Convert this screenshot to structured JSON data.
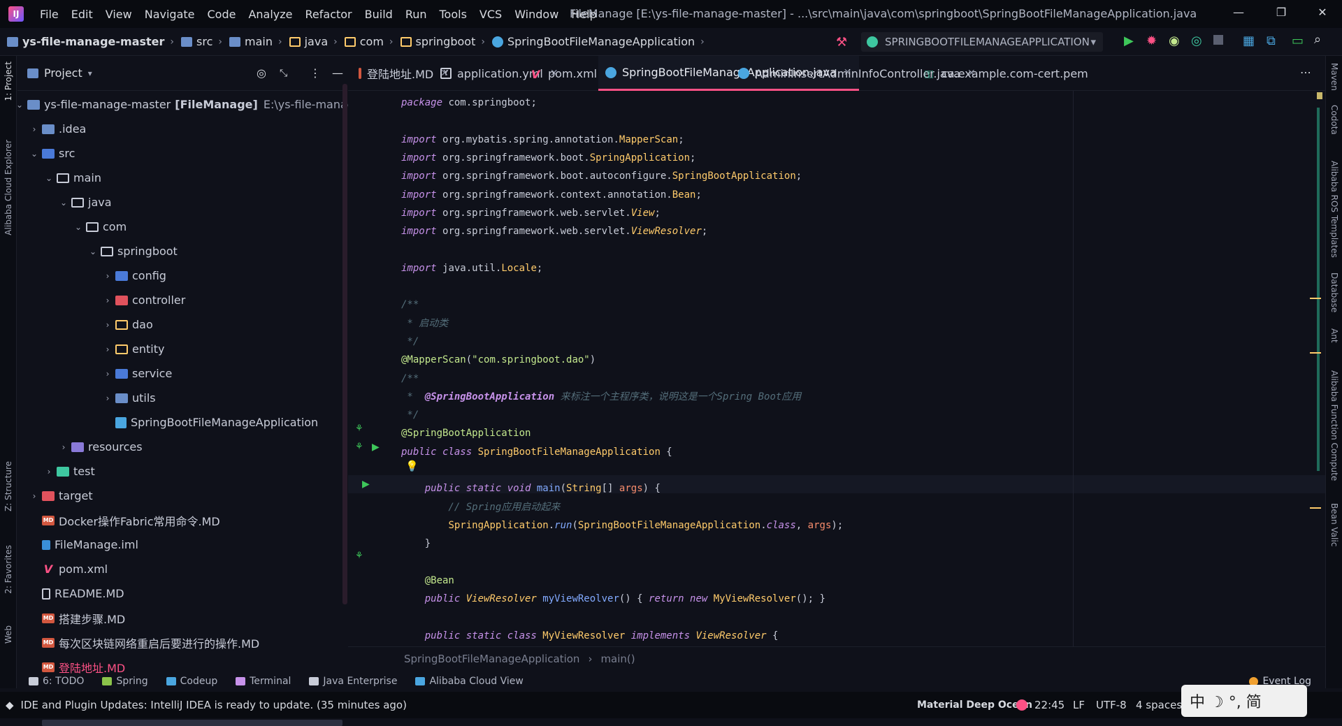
{
  "menu": [
    "File",
    "Edit",
    "View",
    "Navigate",
    "Code",
    "Analyze",
    "Refactor",
    "Build",
    "Run",
    "Tools",
    "VCS",
    "Window",
    "Help"
  ],
  "window_title": "FileManage [E:\\ys-file-manage-master] - ...\\src\\main\\java\\com\\springboot\\SpringBootFileManageApplication.java",
  "window_controls": {
    "minimize": "—",
    "restore": "❐",
    "close": "✕"
  },
  "breadcrumb": [
    "ys-file-manage-master",
    "src",
    "main",
    "java",
    "com",
    "springboot",
    "SpringBootFileManageApplication"
  ],
  "run_config": "SPRINGBOOTFILEMANAGEAPPLICATION",
  "left_strip": {
    "project": "1: Project",
    "cloud": "Alibaba Cloud Explorer",
    "structure": "Z: Structure",
    "favorites": "2: Favorites",
    "web": "Web"
  },
  "right_strip": [
    "Maven",
    "Codota",
    "Alibaba ROS Templates",
    "Database",
    "Ant",
    "Alibaba Function Compute",
    "Bean Valic"
  ],
  "project_panel": {
    "title": "Project",
    "tree": [
      {
        "label": "ys-file-manage-master",
        "bold": "[FileManage]",
        "path": "E:\\ys-file-manage-master",
        "depth": 0,
        "arrow": "⌄",
        "icon": "folder"
      },
      {
        "label": ".idea",
        "depth": 1,
        "arrow": "›",
        "icon": "folder"
      },
      {
        "label": "src",
        "depth": 1,
        "arrow": "⌄",
        "icon": "src"
      },
      {
        "label": "main",
        "depth": 2,
        "arrow": "⌄",
        "icon": "folder-o"
      },
      {
        "label": "java",
        "depth": 3,
        "arrow": "⌄",
        "icon": "folder-o"
      },
      {
        "label": "com",
        "depth": 4,
        "arrow": "⌄",
        "icon": "folder-o"
      },
      {
        "label": "springboot",
        "depth": 5,
        "arrow": "⌄",
        "icon": "folder-o"
      },
      {
        "label": "config",
        "depth": 6,
        "arrow": "›",
        "icon": "src"
      },
      {
        "label": "controller",
        "depth": 6,
        "arrow": "›",
        "icon": "target"
      },
      {
        "label": "dao",
        "depth": 6,
        "arrow": "›",
        "icon": "folder-y"
      },
      {
        "label": "entity",
        "depth": 6,
        "arrow": "›",
        "icon": "folder-y"
      },
      {
        "label": "service",
        "depth": 6,
        "arrow": "›",
        "icon": "src"
      },
      {
        "label": "utils",
        "depth": 6,
        "arrow": "›",
        "icon": "folder"
      },
      {
        "label": "SpringBootFileManageApplication",
        "depth": 6,
        "arrow": "",
        "icon": "java"
      },
      {
        "label": "resources",
        "depth": 3,
        "arrow": "›",
        "icon": "res"
      },
      {
        "label": "test",
        "depth": 2,
        "arrow": "›",
        "icon": "test"
      },
      {
        "label": "target",
        "depth": 1,
        "arrow": "›",
        "icon": "target"
      },
      {
        "label": "Docker操作Fabric常用命令.MD",
        "depth": 1,
        "arrow": "",
        "icon": "md"
      },
      {
        "label": "FileManage.iml",
        "depth": 1,
        "arrow": "",
        "icon": "iml"
      },
      {
        "label": "pom.xml",
        "depth": 1,
        "arrow": "",
        "icon": "pom"
      },
      {
        "label": "README.MD",
        "depth": 1,
        "arrow": "",
        "icon": "readme"
      },
      {
        "label": "搭建步骤.MD",
        "depth": 1,
        "arrow": "",
        "icon": "md"
      },
      {
        "label": "每次区块链网络重启后要进行的操作.MD",
        "depth": 1,
        "arrow": "",
        "icon": "md"
      },
      {
        "label": "登陆地址.MD",
        "depth": 1,
        "arrow": "",
        "icon": "md"
      }
    ]
  },
  "tabs": [
    {
      "label": "登陆地址.MD",
      "icon": "md",
      "active": false
    },
    {
      "label": "application.yml",
      "icon": "yml",
      "active": false
    },
    {
      "label": "pom.xml",
      "icon": "pom",
      "active": false
    },
    {
      "label": "SpringBootFileManageApplication.java",
      "icon": "java",
      "active": true
    },
    {
      "label": "AdminInsertAdminInfoController.java",
      "icon": "java",
      "active": false
    },
    {
      "label": "ca.example.com-cert.pem",
      "icon": "key",
      "active": false
    }
  ],
  "tabs_more": "⋯",
  "code": [
    {
      "line": 0,
      "html": [
        [
          "kw",
          "package "
        ],
        [
          "pkg",
          "com.springboot;"
        ]
      ]
    },
    {
      "line": 2,
      "html": [
        [
          "kw",
          "import "
        ],
        [
          "pkg",
          "org.mybatis.spring.annotation."
        ],
        [
          "cls",
          "MapperScan"
        ],
        [
          "pkg",
          ";"
        ]
      ]
    },
    {
      "line": 3,
      "html": [
        [
          "kw",
          "import "
        ],
        [
          "pkg",
          "org.springframework.boot."
        ],
        [
          "cls",
          "SpringApplication"
        ],
        [
          "pkg",
          ";"
        ]
      ]
    },
    {
      "line": 4,
      "html": [
        [
          "kw",
          "import "
        ],
        [
          "pkg",
          "org.springframework.boot.autoconfigure."
        ],
        [
          "cls",
          "SpringBootApplication"
        ],
        [
          "pkg",
          ";"
        ]
      ]
    },
    {
      "line": 5,
      "html": [
        [
          "kw",
          "import "
        ],
        [
          "pkg",
          "org.springframework.context.annotation."
        ],
        [
          "cls",
          "Bean"
        ],
        [
          "pkg",
          ";"
        ]
      ]
    },
    {
      "line": 6,
      "html": [
        [
          "kw",
          "import "
        ],
        [
          "pkg",
          "org.springframework.web.servlet."
        ],
        [
          "clsi",
          "View"
        ],
        [
          "pkg",
          ";"
        ]
      ]
    },
    {
      "line": 7,
      "html": [
        [
          "kw",
          "import "
        ],
        [
          "pkg",
          "org.springframework.web.servlet."
        ],
        [
          "clsi",
          "ViewResolver"
        ],
        [
          "pkg",
          ";"
        ]
      ]
    },
    {
      "line": 9,
      "html": [
        [
          "kw",
          "import "
        ],
        [
          "pkg",
          "java.util."
        ],
        [
          "cls",
          "Locale"
        ],
        [
          "pkg",
          ";"
        ]
      ]
    },
    {
      "line": 11,
      "html": [
        [
          "cmt",
          "/**"
        ]
      ]
    },
    {
      "line": 12,
      "html": [
        [
          "cmt",
          " * 启动类"
        ]
      ]
    },
    {
      "line": 13,
      "html": [
        [
          "cmt",
          " */"
        ]
      ]
    },
    {
      "line": 14,
      "html": [
        [
          "ann",
          "@MapperScan"
        ],
        [
          "pkg",
          "("
        ],
        [
          "str",
          "\"com.springboot.dao\""
        ],
        [
          "pkg",
          ")"
        ]
      ]
    },
    {
      "line": 15,
      "html": [
        [
          "cmt",
          "/**"
        ]
      ]
    },
    {
      "line": 16,
      "html": [
        [
          "cmt",
          " *  "
        ],
        [
          "doctag",
          "@SpringBootApplication"
        ],
        [
          "cmt",
          " 来标注一个主程序类，说明这是一个Spring Boot应用"
        ]
      ]
    },
    {
      "line": 17,
      "html": [
        [
          "cmt",
          " */"
        ]
      ]
    },
    {
      "line": 18,
      "html": [
        [
          "ann",
          "@SpringBootApplication"
        ]
      ]
    },
    {
      "line": 19,
      "html": [
        [
          "kw",
          "public class "
        ],
        [
          "cls",
          "SpringBootFileManageApplication"
        ],
        [
          "pkg",
          " {"
        ]
      ]
    },
    {
      "line": 21,
      "html": [
        [
          "kw",
          "    public static void "
        ],
        [
          "fn",
          "main"
        ],
        [
          "pkg",
          "("
        ],
        [
          "cls",
          "String"
        ],
        [
          "pkg",
          "[] "
        ],
        [
          "param",
          "args"
        ],
        [
          "pkg",
          ") {"
        ]
      ]
    },
    {
      "line": 22,
      "html": [
        [
          "cmt",
          "        // Spring应用启动起来"
        ]
      ]
    },
    {
      "line": 23,
      "html": [
        [
          "pkg",
          "        "
        ],
        [
          "cls",
          "SpringApplication"
        ],
        [
          "pkg",
          "."
        ],
        [
          "fni",
          "run"
        ],
        [
          "pkg",
          "("
        ],
        [
          "cls",
          "SpringBootFileManageApplication"
        ],
        [
          "pkg",
          "."
        ],
        [
          "kw",
          "class"
        ],
        [
          "pkg",
          ", "
        ],
        [
          "param",
          "args"
        ],
        [
          "pkg",
          ");"
        ]
      ]
    },
    {
      "line": 24,
      "html": [
        [
          "pkg",
          "    }"
        ]
      ]
    },
    {
      "line": 26,
      "html": [
        [
          "ann",
          "    @Bean"
        ]
      ]
    },
    {
      "line": 27,
      "html": [
        [
          "kw",
          "    public "
        ],
        [
          "clsi",
          "ViewResolver "
        ],
        [
          "fn",
          "myViewReolver"
        ],
        [
          "pkg",
          "() { "
        ],
        [
          "kw",
          "return new "
        ],
        [
          "cls",
          "MyViewResolver"
        ],
        [
          "pkg",
          "(); }"
        ]
      ]
    },
    {
      "line": 29,
      "html": [
        [
          "kw",
          "    public static class "
        ],
        [
          "cls",
          "MyViewResolver "
        ],
        [
          "kw",
          "implements "
        ],
        [
          "clsi",
          "ViewResolver"
        ],
        [
          "pkg",
          " {"
        ]
      ]
    }
  ],
  "editor_breadcrumb": [
    "SpringBootFileManageApplication",
    "main()"
  ],
  "bottom_tools": [
    {
      "label": "6: TODO",
      "color": "#c8ccd8"
    },
    {
      "label": "Spring",
      "color": "#8bc34a"
    },
    {
      "label": "Codeup",
      "color": "#4aa6e0"
    },
    {
      "label": "Terminal",
      "color": "#c792ea"
    },
    {
      "label": "Java Enterprise",
      "color": "#c8ccd8"
    },
    {
      "label": "Alibaba Cloud View",
      "color": "#4aa6e0"
    }
  ],
  "event_log": "Event Log",
  "status": {
    "message": "IDE and Plugin Updates: IntelliJ IDEA is ready to update. (35 minutes ago)",
    "theme": "Material Deep Ocean",
    "position": "22:45",
    "line_sep": "LF",
    "encoding": "UTF-8",
    "indent": "4 spaces"
  },
  "ime": "中 ☽ °, 简",
  "colors": {
    "accent": "#fc5185",
    "bg": "#0f111a",
    "keyword": "#c792ea",
    "type": "#ffcb6b",
    "string": "#c3e88d",
    "comment": "#546e7a"
  }
}
